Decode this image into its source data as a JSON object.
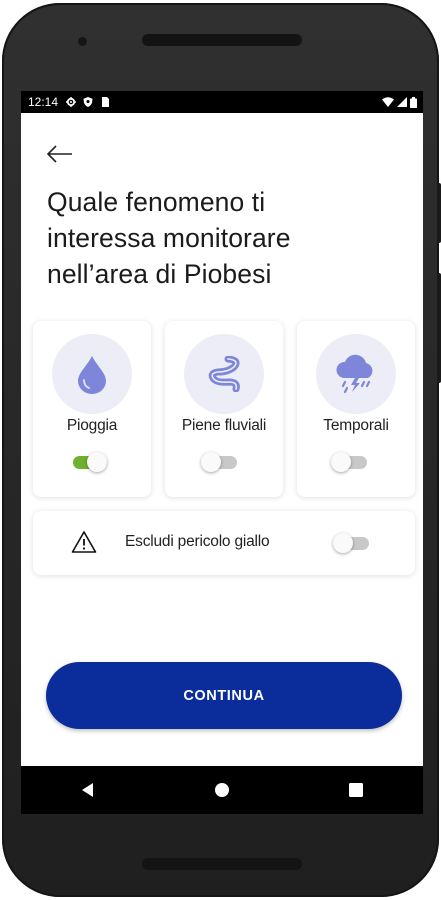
{
  "statusbar": {
    "time": "12:14",
    "left_icons": [
      "settings-icon",
      "shield-icon",
      "sim-card-icon"
    ],
    "right_icons": [
      "wifi-icon",
      "signal-icon",
      "battery-icon"
    ]
  },
  "header": {
    "back_icon": "arrow-left-icon",
    "title_line1": "Quale fenomeno ti",
    "title_line2": "interessa monitorare",
    "title_line3": "nell’area di Piobesi"
  },
  "phenomena": [
    {
      "label": "Pioggia",
      "icon": "raindrop-icon",
      "enabled": true
    },
    {
      "label": "Piene fluviali",
      "icon": "river-icon",
      "enabled": false
    },
    {
      "label": "Temporali",
      "icon": "storm-cloud-icon",
      "enabled": false
    }
  ],
  "exclude_yellow": {
    "label": "Escludi pericolo giallo",
    "icon": "warning-triangle-icon",
    "enabled": false
  },
  "continue_button": {
    "label": "CONTINUA"
  },
  "navbar": {
    "icons": [
      "back-triangle-icon",
      "home-circle-icon",
      "recents-square-icon"
    ]
  },
  "colors": {
    "primary": "#0b2d9c",
    "icon_accent": "#7d86d8",
    "switch_on": "#6fb02f",
    "switch_off": "#c8c8c8",
    "icon_circle_bg": "#ecedf6"
  }
}
